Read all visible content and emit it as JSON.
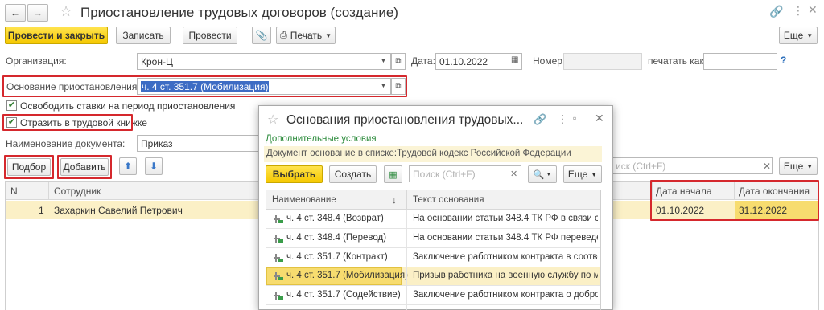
{
  "window": {
    "title": "Приостановление трудовых договоров (создание)"
  },
  "toolbar": {
    "post_close": "Провести и закрыть",
    "save": "Записать",
    "post": "Провести",
    "print": "Печать",
    "more": "Еще"
  },
  "form": {
    "org_label": "Организация:",
    "org_value": "Крон-Ц",
    "date_label": "Дата:",
    "date_value": "01.10.2022",
    "number_label": "Номер:",
    "number_value": "",
    "print_as_label": "печатать как:",
    "print_as_value": "",
    "help": "?",
    "basis_label": "Основание приостановления:",
    "basis_value": "ч. 4 ст. 351.7 (Мобилизация)",
    "free_rates_label": "Освободить ставки на период приостановления",
    "free_rates_checked": true,
    "record_book_label": "Отразить в трудовой книжке",
    "record_book_checked": true,
    "doc_name_label": "Наименование документа:",
    "doc_name_value": "Приказ"
  },
  "table_toolbar": {
    "pick": "Подбор",
    "add": "Добавить",
    "search_placeholder": "иск (Ctrl+F)",
    "more": "Еще"
  },
  "table": {
    "headers": {
      "n": "N",
      "employee": "Сотрудник",
      "start": "Дата начала",
      "end": "Дата окончания"
    },
    "rows": [
      {
        "n": "1",
        "employee": "Захаркин Савелий Петрович",
        "start": "01.10.2022",
        "end": "31.12.2022"
      }
    ]
  },
  "dialog": {
    "title": "Основания приостановления трудовых...",
    "extra_conditions": "Дополнительные условия",
    "filter_note": "Документ основание в списке:Трудовой кодекс Российской Федерации",
    "select": "Выбрать",
    "create": "Создать",
    "search_placeholder": "Поиск (Ctrl+F)",
    "more": "Еще",
    "col_name": "Наименование",
    "col_text": "Текст основания",
    "sort_arrow": "↓",
    "rows": [
      {
        "name": "ч. 4 ст. 348.4 (Возврат)",
        "text": "На основании статьи 348.4 ТК РФ в связи с..."
      },
      {
        "name": "ч. 4 ст. 348.4 (Перевод)",
        "text": "На основании статьи 348.4 ТК РФ переведе..."
      },
      {
        "name": "ч. 4 ст. 351.7 (Контракт)",
        "text": "Заключение работником контракта в соотве..."
      },
      {
        "name": "ч. 4 ст. 351.7 (Мобилизация)",
        "text": "Призыв работника на военную службу по м..."
      },
      {
        "name": "ч. 4 ст. 351.7 (Содействие)",
        "text": "Заключение работником контракта о добров..."
      }
    ]
  }
}
